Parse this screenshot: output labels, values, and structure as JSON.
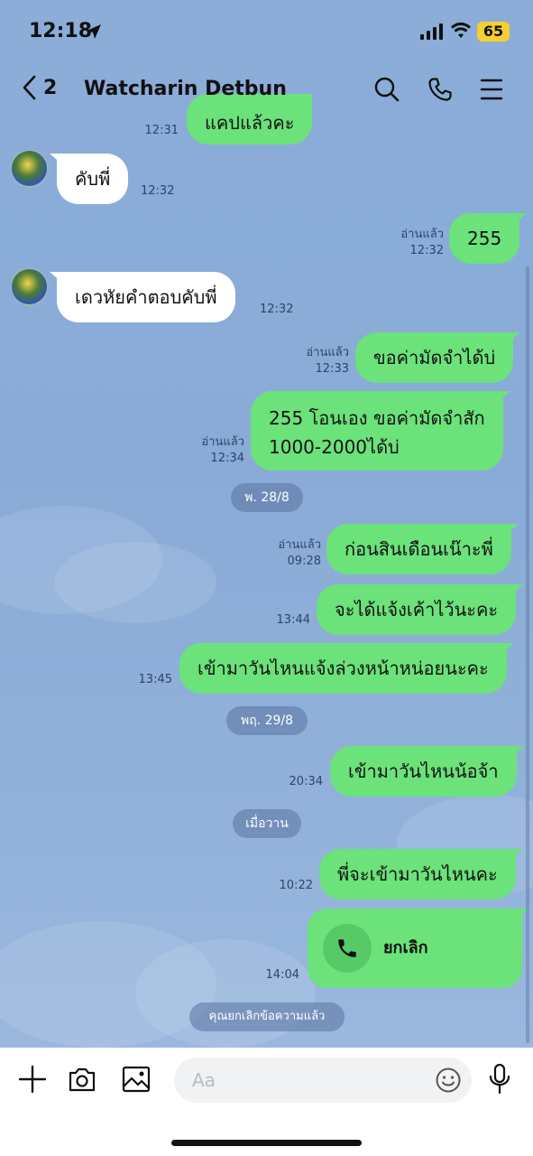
{
  "status_bar": {
    "time": "12:18",
    "battery": "65"
  },
  "header": {
    "back_count": "2",
    "title": "Watcharin Detbun"
  },
  "messages": {
    "m0": {
      "text": "แคปแล้วคะ",
      "time": "12:31"
    },
    "m1": {
      "text": "คับพี่",
      "time": "12:32"
    },
    "m2": {
      "text": "255",
      "read": "อ่านแล้ว",
      "time": "12:32"
    },
    "m3": {
      "text": "เดวหัยคำตอบคับพี่",
      "time": "12:32"
    },
    "m4": {
      "text": "ขอค่ามัดจำได้บ่",
      "read": "อ่านแล้ว",
      "time": "12:33"
    },
    "m5": {
      "line1": "255 โอนเอง ขอค่ามัดจำสัก",
      "line2": "1000-2000ได้บ่",
      "read": "อ่านแล้ว",
      "time": "12:34"
    },
    "d1": {
      "text": "พ. 28/8"
    },
    "m6": {
      "text": "ก่อนสินเดือนเน๊าะพี่",
      "read": "อ่านแล้ว",
      "time": "09:28"
    },
    "m7": {
      "text": "จะได้แจ้งเค้าไว้นะคะ",
      "time": "13:44"
    },
    "m8": {
      "text": "เข้ามาวันไหนแจ้งล่วงหน้าหน่อยนะคะ",
      "time": "13:45"
    },
    "d2": {
      "text": "พฤ. 29/8"
    },
    "m9": {
      "text": "เข้ามาวันไหนน้อจ้า",
      "time": "20:34"
    },
    "d3": {
      "text": "เมื่อวาน"
    },
    "m10": {
      "text": "พี่จะเข้ามาวันไหนคะ",
      "time": "10:22"
    },
    "call": {
      "label": "ยกเลิก",
      "time": "14:04"
    },
    "system": {
      "text": "คุณยกเลิกข้อความแล้ว"
    }
  },
  "input": {
    "placeholder": "Aa"
  },
  "icons": {
    "back": "chevron-left-icon",
    "search": "search-icon",
    "call": "phone-icon",
    "menu": "menu-icon",
    "add": "plus-icon",
    "camera": "camera-icon",
    "gallery": "image-icon",
    "emoji": "emoji-icon",
    "mic": "microphone-icon"
  },
  "colors": {
    "chat_background": "#8badd8",
    "outgoing_bubble": "#6be27a",
    "incoming_bubble": "#ffffff",
    "battery": "#f6cf30"
  }
}
